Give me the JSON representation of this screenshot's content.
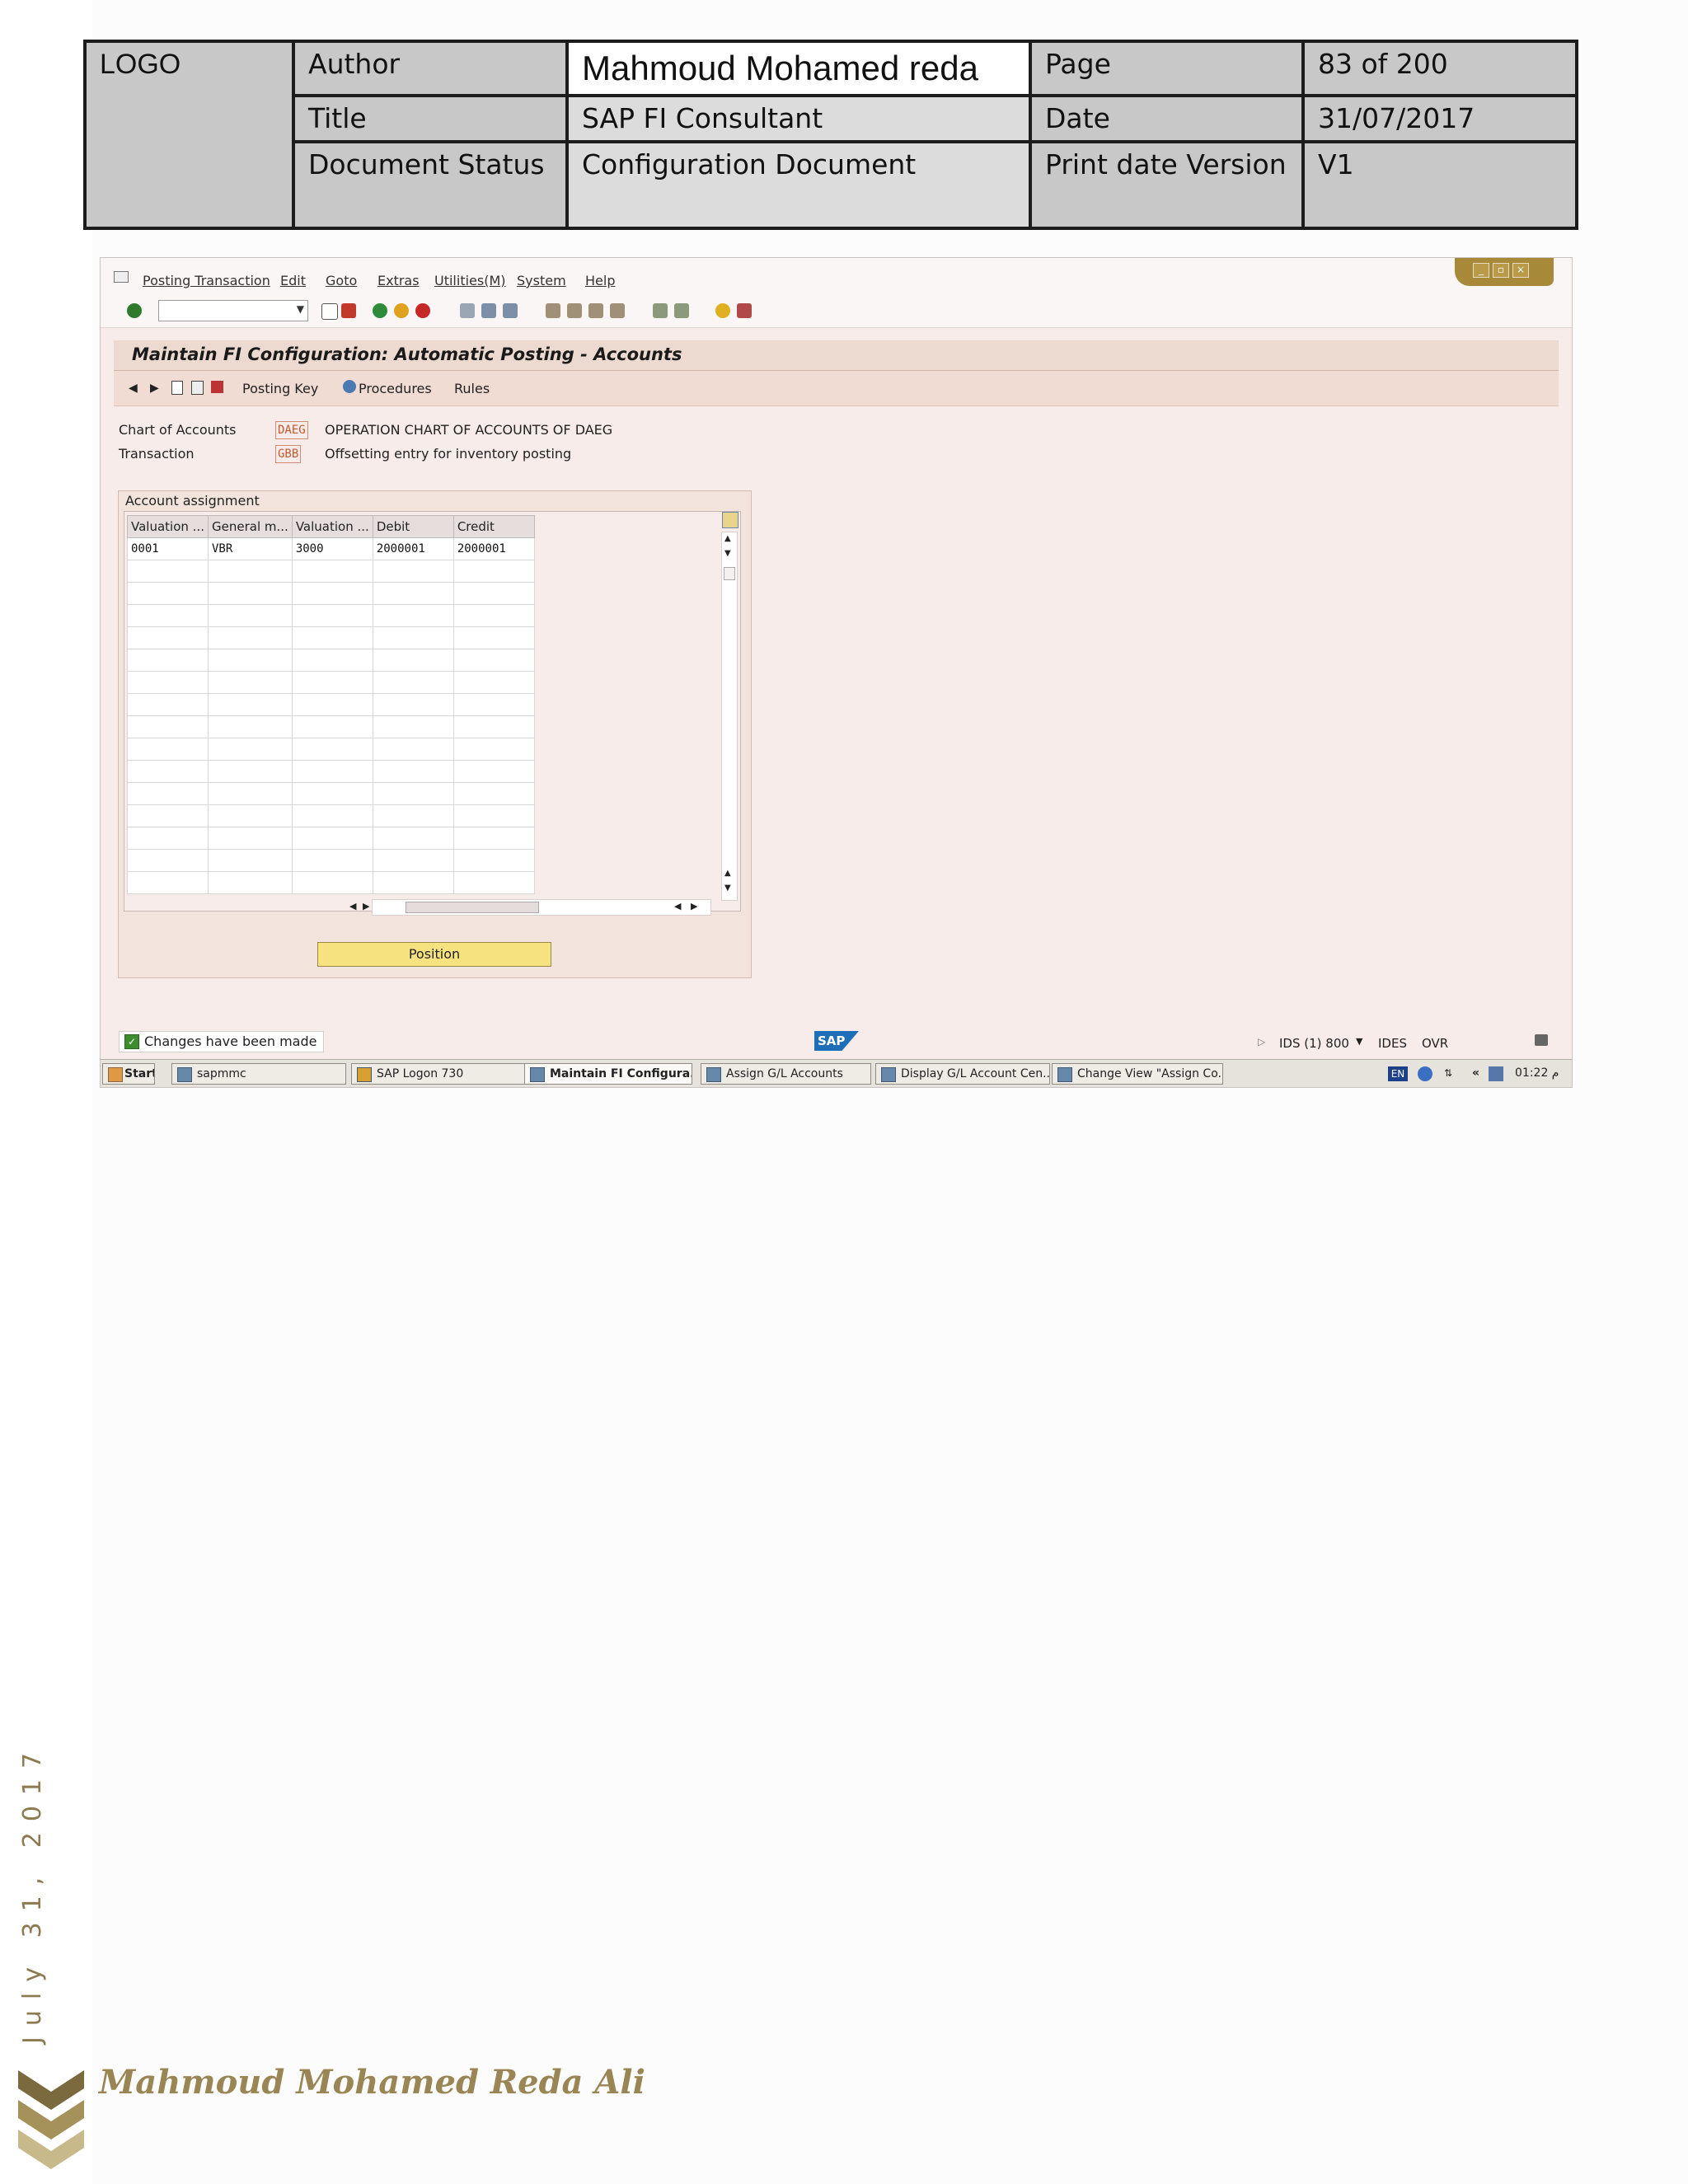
{
  "header": {
    "logo": "LOGO",
    "author_label": "Author",
    "author_value": "Mahmoud Mohamed reda",
    "page_label": "Page",
    "page_value": "83 of 200",
    "title_label": "Title",
    "title_value": "SAP FI Consultant",
    "date_label": "Date",
    "date_value": "31/07/2017",
    "status_label": "Document Status",
    "status_value": "Configuration Document",
    "print_label": "Print date Version",
    "print_value": "V1"
  },
  "sap": {
    "menu": [
      "Posting Transaction",
      "Edit",
      "Goto",
      "Extras",
      "Utilities(M)",
      "System",
      "Help"
    ],
    "screen_title": "Maintain FI Configuration: Automatic Posting - Accounts",
    "app_toolbar": {
      "posting_key": "Posting Key",
      "procedures": "Procedures",
      "rules": "Rules"
    },
    "fields": {
      "chart_label": "Chart of Accounts",
      "chart_code": "DAEG",
      "chart_desc": "OPERATION CHART OF ACCOUNTS OF DAEG",
      "transaction_label": "Transaction",
      "transaction_code": "GBB",
      "transaction_desc": "Offsetting entry for inventory posting"
    },
    "group_title": "Account assignment",
    "table": {
      "headers": [
        "Valuation ...",
        "General m...",
        "Valuation ...",
        "Debit",
        "Credit"
      ],
      "rows": [
        [
          "0001",
          "VBR",
          "3000",
          "2000001",
          "2000001"
        ]
      ]
    },
    "position_button": "Position",
    "status_message": "Changes have been made",
    "sap_logo": "SAP",
    "system": {
      "ids": "IDS (1) 800",
      "client": "IDES",
      "mode": "OVR"
    },
    "taskbar": {
      "start": "Start",
      "tasks": [
        "sapmmc",
        "SAP Logon 730",
        "Maintain FI Configura...",
        "Assign G/L Accounts",
        "Display G/L Account Cen...",
        "Change View \"Assign Co..."
      ],
      "lang": "EN",
      "clock": "01:22 م"
    }
  },
  "footer": {
    "side_date": "July 31, 2017",
    "signature": "Mahmoud Mohamed Reda Ali"
  },
  "colors": {
    "sap_background": "#f7ecea",
    "title_band": "#ecd9cf",
    "accent_gold": "#9a8654",
    "button_yellow": "#f6e27e"
  }
}
